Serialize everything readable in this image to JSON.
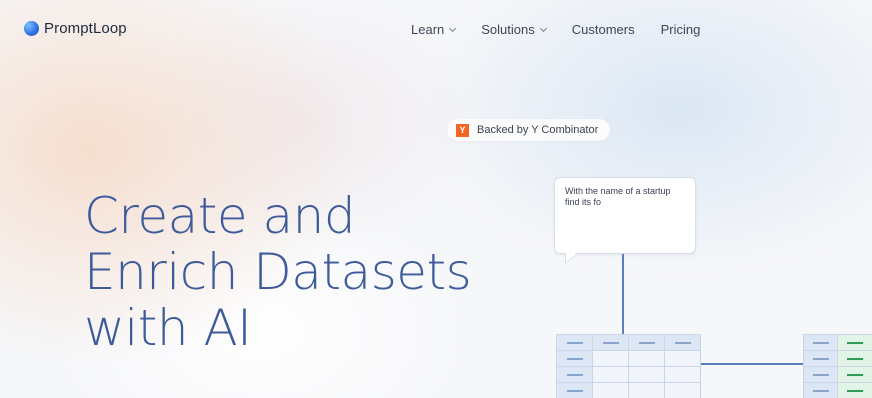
{
  "brand": {
    "name": "PromptLoop",
    "accent": "#3d5a9a",
    "logo_icon": "gradient-circle"
  },
  "nav": {
    "links": [
      {
        "label": "Learn",
        "has_dropdown": true
      },
      {
        "label": "Solutions",
        "has_dropdown": true
      },
      {
        "label": "Customers",
        "has_dropdown": false
      },
      {
        "label": "Pricing",
        "has_dropdown": false
      }
    ]
  },
  "badge": {
    "icon": "y-combinator-icon",
    "icon_text": "Y",
    "label": "Backed by Y Combinator",
    "icon_color": "#f26522"
  },
  "hero": {
    "lines": [
      "Create and",
      "Enrich Datasets",
      "with AI"
    ]
  },
  "illustration": {
    "prompt_text": "With the name of a startup find its fo",
    "line_color": "#5b7fb8",
    "output_color": "#2b9b55"
  }
}
